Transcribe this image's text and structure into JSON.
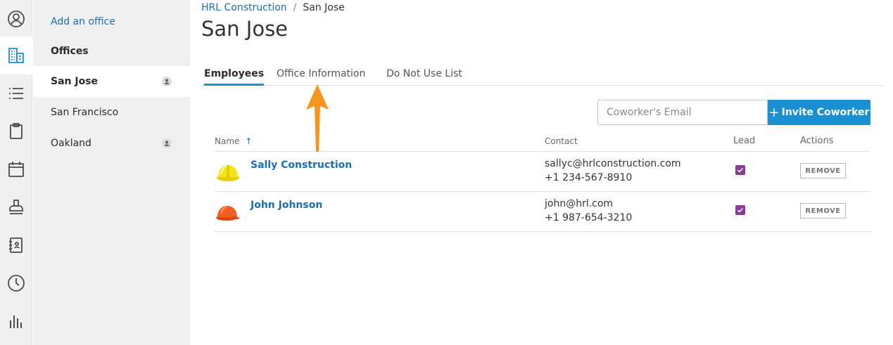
{
  "rail": {
    "icons": [
      "user-circle-icon",
      "building-icon",
      "list-icon",
      "clipboard-icon",
      "calendar-icon",
      "stamp-icon",
      "address-book-icon",
      "clock-icon",
      "bar-chart-icon"
    ],
    "active_icon": "building-icon"
  },
  "sidebar": {
    "add_office": "Add an office",
    "heading": "Offices",
    "items": [
      {
        "label": "San Jose",
        "selected": true,
        "lead_icon": true
      },
      {
        "label": "San Francisco",
        "selected": false,
        "lead_icon": false
      },
      {
        "label": "Oakland",
        "selected": false,
        "lead_icon": true
      }
    ]
  },
  "breadcrumb": {
    "parent": "HRL Construction",
    "separator": "/",
    "current": "San Jose"
  },
  "page_title": "San Jose",
  "tabs": [
    {
      "label": "Employees",
      "active": true
    },
    {
      "label": "Office Information",
      "active": false
    },
    {
      "label": "Do Not Use List",
      "active": false
    }
  ],
  "invite": {
    "email_placeholder": "Coworker's Email",
    "email_value": "",
    "button_plus": "+",
    "button_label": "Invite Coworker"
  },
  "table": {
    "headers": {
      "name": "Name",
      "sort_indicator": "↑",
      "contact": "Contact",
      "lead": "Lead",
      "actions": "Actions"
    },
    "rows": [
      {
        "name": "Sally Construction",
        "email": "sallyc@hrlconstruction.com",
        "phone": "+1 234-567-8910",
        "lead": true,
        "action": "REMOVE",
        "avatar": "yellow-hardhat-icon"
      },
      {
        "name": "John Johnson",
        "email": "john@hrl.com",
        "phone": "+1 987-654-3210",
        "lead": true,
        "action": "REMOVE",
        "avatar": "orange-hardhat-icon"
      }
    ]
  },
  "colors": {
    "accent": "#1a8fd1",
    "link": "#1a6fb5",
    "checkbox": "#8b3a9a",
    "annotation_arrow": "#f7941d"
  }
}
